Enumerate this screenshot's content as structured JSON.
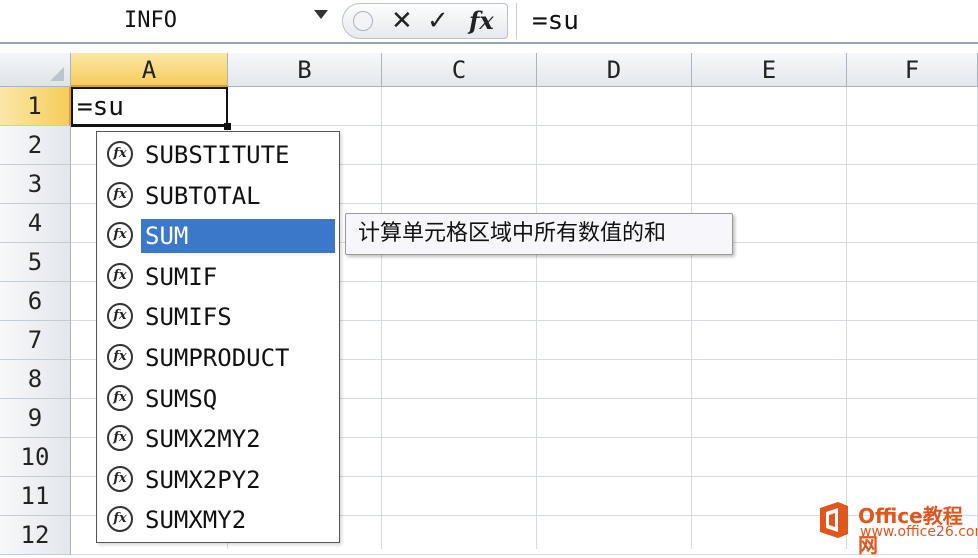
{
  "formula_bar": {
    "name_box": "INFO",
    "formula": "=su"
  },
  "grid": {
    "columns": [
      "A",
      "B",
      "C",
      "D",
      "E",
      "F"
    ],
    "rows": [
      "1",
      "2",
      "3",
      "4",
      "5",
      "6",
      "7",
      "8",
      "9",
      "10",
      "11",
      "12"
    ],
    "active_cell_value": "=su"
  },
  "autocomplete": {
    "items": [
      "SUBSTITUTE",
      "SUBTOTAL",
      "SUM",
      "SUMIF",
      "SUMIFS",
      "SUMPRODUCT",
      "SUMSQ",
      "SUMX2MY2",
      "SUMX2PY2",
      "SUMXMY2"
    ],
    "selected": "SUM",
    "icon": "fx-function-icon",
    "icon_text": "fx"
  },
  "tooltip": {
    "text": "计算单元格区域中所有数值的和"
  },
  "watermark": {
    "name": "Office教程网",
    "url": "www.office26.com"
  },
  "colors": {
    "selection": "#3c78c9",
    "active_header": "#f6cd5a",
    "watermark": "#e0561d"
  }
}
